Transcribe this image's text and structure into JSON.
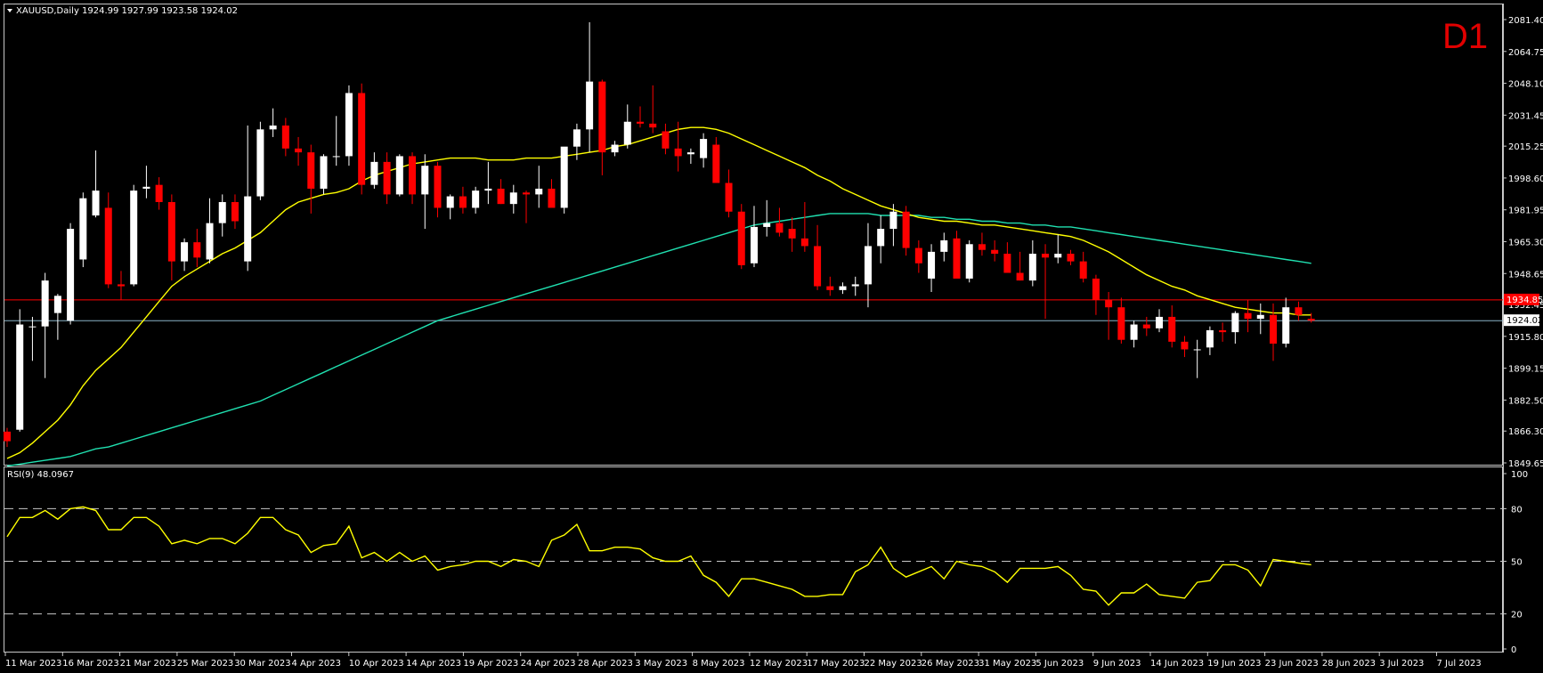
{
  "header": {
    "symbol": "XAUUSD,Daily",
    "ohlc": "1924.99 1927.99 1923.58 1924.02",
    "timeframe_badge": "D1"
  },
  "rsi_header": {
    "label": "RSI(9) 48.0967"
  },
  "price_axis": {
    "ticks": [
      "2081.40",
      "2064.75",
      "2048.10",
      "2031.45",
      "2015.25",
      "1998.60",
      "1981.95",
      "1965.30",
      "1948.65",
      "1932.45",
      "1915.80",
      "1899.15",
      "1882.50",
      "1866.30",
      "1849.65"
    ],
    "current_price_label": "1924.02",
    "red_line_label": "1934.85"
  },
  "rsi_axis": {
    "ticks": [
      "100",
      "80",
      "50",
      "20",
      "0"
    ]
  },
  "date_axis": {
    "labels": [
      "11 Mar 2023",
      "16 Mar 2023",
      "21 Mar 2023",
      "25 Mar 2023",
      "30 Mar 2023",
      "4 Apr 2023",
      "10 Apr 2023",
      "14 Apr 2023",
      "19 Apr 2023",
      "24 Apr 2023",
      "28 Apr 2023",
      "3 May 2023",
      "8 May 2023",
      "12 May 2023",
      "17 May 2023",
      "22 May 2023",
      "26 May 2023",
      "31 May 2023",
      "5 Jun 2023",
      "9 Jun 2023",
      "14 Jun 2023",
      "19 Jun 2023",
      "23 Jun 2023",
      "28 Jun 2023",
      "3 Jul 2023",
      "7 Jul 2023"
    ]
  },
  "colors": {
    "bull": "#ffffff",
    "bear": "#ff0000",
    "ma_fast": "#ffff00",
    "ma_slow": "#20e0b0",
    "rsi": "#ffff00",
    "red_line": "#ff0000",
    "grey_line": "#8ab4c8"
  },
  "chart_data": {
    "type": "candlestick",
    "symbol": "XAUUSD",
    "timeframe": "Daily",
    "ylim": [
      1849.65,
      2081.4
    ],
    "horizontal_lines": [
      1934.85,
      1924.02
    ],
    "candles": [
      {
        "o": 1866,
        "h": 1868,
        "l": 1858,
        "c": 1861
      },
      {
        "o": 1867,
        "h": 1930,
        "l": 1866,
        "c": 1922
      },
      {
        "o": 1921,
        "h": 1926,
        "l": 1903,
        "c": 1921
      },
      {
        "o": 1921,
        "h": 1949,
        "l": 1894,
        "c": 1945
      },
      {
        "o": 1928,
        "h": 1938,
        "l": 1914,
        "c": 1937
      },
      {
        "o": 1924,
        "h": 1975,
        "l": 1922,
        "c": 1972
      },
      {
        "o": 1956,
        "h": 1991,
        "l": 1952,
        "c": 1988
      },
      {
        "o": 1979,
        "h": 2013,
        "l": 1978,
        "c": 1992
      },
      {
        "o": 1983,
        "h": 1991,
        "l": 1941,
        "c": 1943
      },
      {
        "o": 1943,
        "h": 1950,
        "l": 1935,
        "c": 1942
      },
      {
        "o": 1943,
        "h": 1995,
        "l": 1942,
        "c": 1992
      },
      {
        "o": 1993,
        "h": 2005,
        "l": 1988,
        "c": 1994
      },
      {
        "o": 1995,
        "h": 1999,
        "l": 1982,
        "c": 1986
      },
      {
        "o": 1986,
        "h": 1990,
        "l": 1945,
        "c": 1955
      },
      {
        "o": 1955,
        "h": 1967,
        "l": 1950,
        "c": 1965
      },
      {
        "o": 1965,
        "h": 1972,
        "l": 1952,
        "c": 1957
      },
      {
        "o": 1956,
        "h": 1988,
        "l": 1954,
        "c": 1975
      },
      {
        "o": 1975,
        "h": 1990,
        "l": 1968,
        "c": 1986
      },
      {
        "o": 1986,
        "h": 1990,
        "l": 1972,
        "c": 1976
      },
      {
        "o": 1955,
        "h": 2026,
        "l": 1950,
        "c": 1989
      },
      {
        "o": 1989,
        "h": 2028,
        "l": 1987,
        "c": 2024
      },
      {
        "o": 2024,
        "h": 2035,
        "l": 2020,
        "c": 2026
      },
      {
        "o": 2026,
        "h": 2030,
        "l": 2010,
        "c": 2014
      },
      {
        "o": 2014,
        "h": 2020,
        "l": 2005,
        "c": 2012
      },
      {
        "o": 2012,
        "h": 2016,
        "l": 1980,
        "c": 1993
      },
      {
        "o": 1993,
        "h": 2011,
        "l": 1990,
        "c": 2010
      },
      {
        "o": 2010,
        "h": 2031,
        "l": 2005,
        "c": 2010
      },
      {
        "o": 2010,
        "h": 2047,
        "l": 2005,
        "c": 2043
      },
      {
        "o": 2043,
        "h": 2048,
        "l": 1990,
        "c": 1995
      },
      {
        "o": 1995,
        "h": 2012,
        "l": 1993,
        "c": 2007
      },
      {
        "o": 2007,
        "h": 2012,
        "l": 1985,
        "c": 1990
      },
      {
        "o": 1990,
        "h": 2011,
        "l": 1989,
        "c": 2010
      },
      {
        "o": 2010,
        "h": 2012,
        "l": 1985,
        "c": 1990
      },
      {
        "o": 1990,
        "h": 2011,
        "l": 1972,
        "c": 2005
      },
      {
        "o": 2005,
        "h": 2007,
        "l": 1978,
        "c": 1983
      },
      {
        "o": 1983,
        "h": 1990,
        "l": 1977,
        "c": 1989
      },
      {
        "o": 1989,
        "h": 1994,
        "l": 1980,
        "c": 1983
      },
      {
        "o": 1983,
        "h": 1994,
        "l": 1980,
        "c": 1992
      },
      {
        "o": 1992,
        "h": 2007,
        "l": 1985,
        "c": 1993
      },
      {
        "o": 1993,
        "h": 1998,
        "l": 1985,
        "c": 1985
      },
      {
        "o": 1985,
        "h": 1995,
        "l": 1980,
        "c": 1991
      },
      {
        "o": 1991,
        "h": 1992,
        "l": 1975,
        "c": 1990
      },
      {
        "o": 1990,
        "h": 2005,
        "l": 1983,
        "c": 1993
      },
      {
        "o": 1993,
        "h": 1998,
        "l": 1985,
        "c": 1983
      },
      {
        "o": 1983,
        "h": 2005,
        "l": 1980,
        "c": 2015
      },
      {
        "o": 2015,
        "h": 2027,
        "l": 2008,
        "c": 2024
      },
      {
        "o": 2024,
        "h": 2080,
        "l": 2012,
        "c": 2049
      },
      {
        "o": 2049,
        "h": 2050,
        "l": 2000,
        "c": 2012
      },
      {
        "o": 2012,
        "h": 2018,
        "l": 2010,
        "c": 2016
      },
      {
        "o": 2016,
        "h": 2037,
        "l": 2014,
        "c": 2028
      },
      {
        "o": 2028,
        "h": 2036,
        "l": 2025,
        "c": 2027
      },
      {
        "o": 2027,
        "h": 2047,
        "l": 2022,
        "c": 2025
      },
      {
        "o": 2023,
        "h": 2027,
        "l": 2011,
        "c": 2014
      },
      {
        "o": 2014,
        "h": 2028,
        "l": 2002,
        "c": 2010
      },
      {
        "o": 2011,
        "h": 2014,
        "l": 2006,
        "c": 2012
      },
      {
        "o": 2009,
        "h": 2022,
        "l": 2004,
        "c": 2019
      },
      {
        "o": 2016,
        "h": 2020,
        "l": 1998,
        "c": 1996
      },
      {
        "o": 1996,
        "h": 2003,
        "l": 1978,
        "c": 1981
      },
      {
        "o": 1981,
        "h": 1985,
        "l": 1951,
        "c": 1953
      },
      {
        "o": 1954,
        "h": 1984,
        "l": 1952,
        "c": 1973
      },
      {
        "o": 1973,
        "h": 1987,
        "l": 1968,
        "c": 1975
      },
      {
        "o": 1975,
        "h": 1983,
        "l": 1968,
        "c": 1970
      },
      {
        "o": 1972,
        "h": 1978,
        "l": 1960,
        "c": 1967
      },
      {
        "o": 1967,
        "h": 1986,
        "l": 1960,
        "c": 1963
      },
      {
        "o": 1963,
        "h": 1974,
        "l": 1940,
        "c": 1942
      },
      {
        "o": 1942,
        "h": 1947,
        "l": 1937,
        "c": 1940
      },
      {
        "o": 1940,
        "h": 1944,
        "l": 1938,
        "c": 1942
      },
      {
        "o": 1942,
        "h": 1947,
        "l": 1937,
        "c": 1943
      },
      {
        "o": 1943,
        "h": 1975,
        "l": 1931,
        "c": 1963
      },
      {
        "o": 1963,
        "h": 1979,
        "l": 1954,
        "c": 1972
      },
      {
        "o": 1972,
        "h": 1985,
        "l": 1963,
        "c": 1981
      },
      {
        "o": 1981,
        "h": 1984,
        "l": 1958,
        "c": 1962
      },
      {
        "o": 1962,
        "h": 1966,
        "l": 1949,
        "c": 1954
      },
      {
        "o": 1946,
        "h": 1964,
        "l": 1939,
        "c": 1960
      },
      {
        "o": 1960,
        "h": 1970,
        "l": 1955,
        "c": 1966
      },
      {
        "o": 1967,
        "h": 1971,
        "l": 1950,
        "c": 1946
      },
      {
        "o": 1946,
        "h": 1966,
        "l": 1944,
        "c": 1964
      },
      {
        "o": 1964,
        "h": 1970,
        "l": 1958,
        "c": 1961
      },
      {
        "o": 1961,
        "h": 1966,
        "l": 1955,
        "c": 1959
      },
      {
        "o": 1959,
        "h": 1965,
        "l": 1951,
        "c": 1949
      },
      {
        "o": 1949,
        "h": 1960,
        "l": 1945,
        "c": 1945
      },
      {
        "o": 1945,
        "h": 1966,
        "l": 1942,
        "c": 1959
      },
      {
        "o": 1959,
        "h": 1964,
        "l": 1925,
        "c": 1957
      },
      {
        "o": 1957,
        "h": 1969,
        "l": 1954,
        "c": 1959
      },
      {
        "o": 1959,
        "h": 1961,
        "l": 1953,
        "c": 1955
      },
      {
        "o": 1955,
        "h": 1960,
        "l": 1944,
        "c": 1946
      },
      {
        "o": 1946,
        "h": 1948,
        "l": 1927,
        "c": 1935
      },
      {
        "o": 1935,
        "h": 1939,
        "l": 1914,
        "c": 1931
      },
      {
        "o": 1931,
        "h": 1936,
        "l": 1912,
        "c": 1914
      },
      {
        "o": 1914,
        "h": 1924,
        "l": 1910,
        "c": 1922
      },
      {
        "o": 1922,
        "h": 1926,
        "l": 1916,
        "c": 1920
      },
      {
        "o": 1920,
        "h": 1930,
        "l": 1918,
        "c": 1926
      },
      {
        "o": 1926,
        "h": 1932,
        "l": 1910,
        "c": 1913
      },
      {
        "o": 1913,
        "h": 1916,
        "l": 1905,
        "c": 1909
      },
      {
        "o": 1909,
        "h": 1914,
        "l": 1894,
        "c": 1909
      },
      {
        "o": 1910,
        "h": 1921,
        "l": 1906,
        "c": 1919
      },
      {
        "o": 1919,
        "h": 1923,
        "l": 1913,
        "c": 1918
      },
      {
        "o": 1918,
        "h": 1929,
        "l": 1912,
        "c": 1928
      },
      {
        "o": 1928,
        "h": 1935,
        "l": 1918,
        "c": 1925
      },
      {
        "o": 1925,
        "h": 1933,
        "l": 1917,
        "c": 1927
      },
      {
        "o": 1927,
        "h": 1933,
        "l": 1903,
        "c": 1912
      },
      {
        "o": 1912,
        "h": 1936,
        "l": 1910,
        "c": 1931
      },
      {
        "o": 1931,
        "h": 1934,
        "l": 1924,
        "c": 1927
      },
      {
        "o": 1925,
        "h": 1928,
        "l": 1923,
        "c": 1924
      }
    ],
    "ma_fast": [
      1852,
      1855,
      1860,
      1866,
      1872,
      1880,
      1890,
      1898,
      1904,
      1910,
      1918,
      1926,
      1934,
      1942,
      1947,
      1951,
      1955,
      1959,
      1962,
      1966,
      1970,
      1976,
      1982,
      1986,
      1988,
      1990,
      1991,
      1993,
      1997,
      2000,
      2002,
      2004,
      2006,
      2007,
      2008,
      2009,
      2009,
      2009,
      2008,
      2008,
      2008,
      2009,
      2009,
      2009,
      2010,
      2011,
      2012,
      2013,
      2015,
      2016,
      2018,
      2020,
      2022,
      2024,
      2025,
      2025,
      2024,
      2022,
      2019,
      2016,
      2013,
      2010,
      2007,
      2004,
      2000,
      1997,
      1993,
      1990,
      1987,
      1984,
      1982,
      1980,
      1978,
      1977,
      1976,
      1976,
      1975,
      1974,
      1974,
      1973,
      1972,
      1971,
      1970,
      1969,
      1968,
      1966,
      1963,
      1960,
      1956,
      1952,
      1948,
      1945,
      1942,
      1940,
      1937,
      1935,
      1933,
      1931,
      1930,
      1929,
      1928,
      1928,
      1927,
      1927
    ],
    "ma_slow": [
      1848,
      1849,
      1850,
      1851,
      1852,
      1853,
      1855,
      1857,
      1858,
      1860,
      1862,
      1864,
      1866,
      1868,
      1870,
      1872,
      1874,
      1876,
      1878,
      1880,
      1882,
      1885,
      1888,
      1891,
      1894,
      1897,
      1900,
      1903,
      1906,
      1909,
      1912,
      1915,
      1918,
      1921,
      1924,
      1926,
      1928,
      1930,
      1932,
      1934,
      1936,
      1938,
      1940,
      1942,
      1944,
      1946,
      1948,
      1950,
      1952,
      1954,
      1956,
      1958,
      1960,
      1962,
      1964,
      1966,
      1968,
      1970,
      1972,
      1974,
      1975,
      1976,
      1977,
      1978,
      1979,
      1980,
      1980,
      1980,
      1980,
      1979,
      1979,
      1979,
      1979,
      1978,
      1978,
      1977,
      1977,
      1976,
      1976,
      1975,
      1975,
      1974,
      1974,
      1973,
      1973,
      1972,
      1971,
      1970,
      1969,
      1968,
      1967,
      1966,
      1965,
      1964,
      1963,
      1962,
      1961,
      1960,
      1959,
      1958,
      1957,
      1956,
      1955,
      1954
    ],
    "rsi": {
      "period": 9,
      "current": 48.0967,
      "levels": [
        80,
        50,
        20
      ],
      "ylim": [
        0,
        100
      ],
      "values": [
        64,
        75,
        75,
        79,
        74,
        80,
        81,
        79,
        68,
        68,
        75,
        75,
        70,
        60,
        62,
        60,
        63,
        63,
        60,
        66,
        75,
        75,
        68,
        65,
        55,
        59,
        60,
        70,
        52,
        55,
        50,
        55,
        50,
        53,
        45,
        47,
        48,
        50,
        50,
        47,
        51,
        50,
        47,
        62,
        65,
        71,
        56,
        56,
        58,
        58,
        57,
        52,
        50,
        50,
        53,
        42,
        38,
        30,
        40,
        40,
        38,
        36,
        34,
        30,
        30,
        31,
        31,
        44,
        48,
        58,
        46,
        41,
        44,
        47,
        40,
        50,
        48,
        47,
        44,
        38,
        46,
        46,
        46,
        47,
        42,
        34,
        33,
        25,
        32,
        32,
        37,
        31,
        30,
        29,
        38,
        39,
        48,
        48,
        45,
        36,
        51,
        50,
        49,
        48
      ]
    }
  }
}
